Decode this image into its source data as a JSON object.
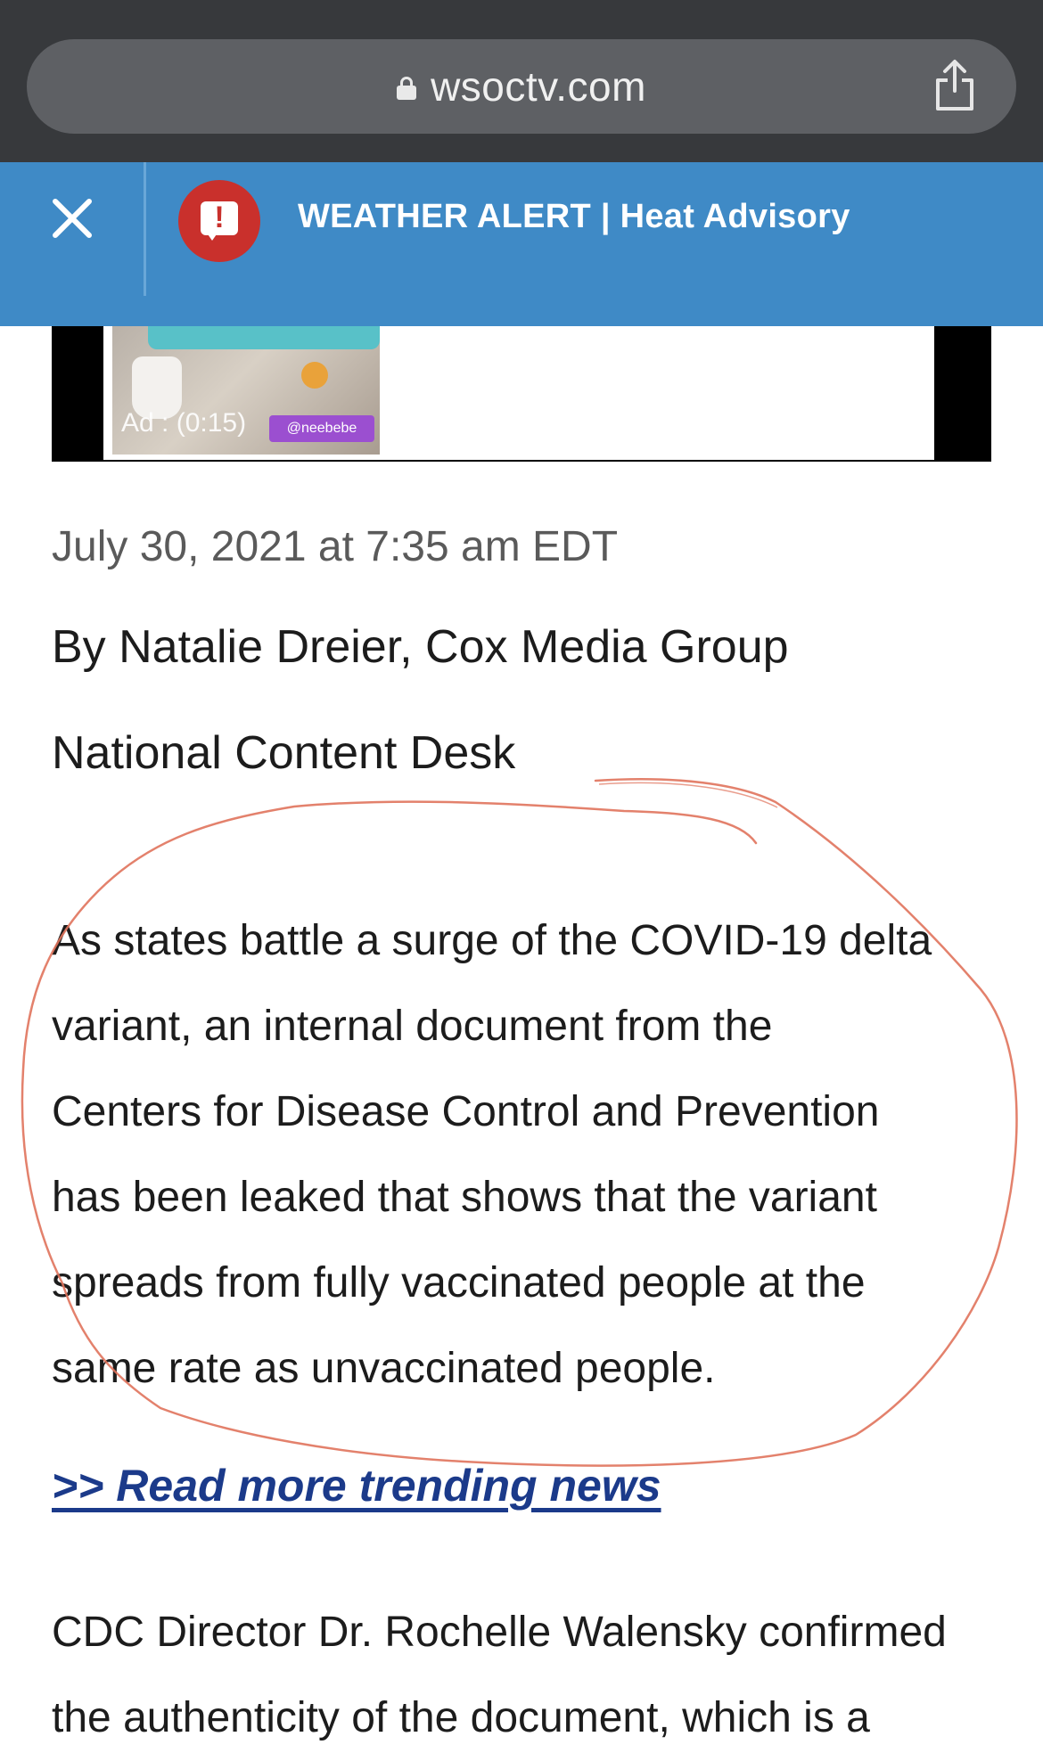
{
  "browser": {
    "url": "wsoctv.com"
  },
  "alert": {
    "text": "WEATHER ALERT | Heat Advisory"
  },
  "ad": {
    "label": "Ad : (0:15)",
    "tag": "@neebebe"
  },
  "article": {
    "timestamp": "July 30, 2021 at 7:35 am EDT",
    "byline": "By Natalie Dreier, Cox Media Group",
    "desk": "National Content Desk",
    "paragraph_lines": [
      "As states battle a surge of the COVID-19 delta",
      "variant, an internal document from the",
      "Centers for Disease Control and Prevention",
      "has been leaked that shows that the variant",
      "spreads from fully vaccinated people at the",
      "same rate as unvaccinated people."
    ],
    "trending_link": ">> Read more trending news",
    "paragraph2_lines": [
      "CDC Director Dr. Rochelle Walensky confirmed",
      "the authenticity of the document, which is a"
    ]
  },
  "colors": {
    "chrome_bg": "#37393c",
    "alert_bg": "#3f8ac6",
    "alert_icon": "#c9302c",
    "link": "#1b3a8a",
    "annotation": "#e0735c"
  },
  "icons": {
    "lock": "lock-icon",
    "share": "share-icon",
    "close": "close-icon",
    "alert": "alert-icon"
  }
}
